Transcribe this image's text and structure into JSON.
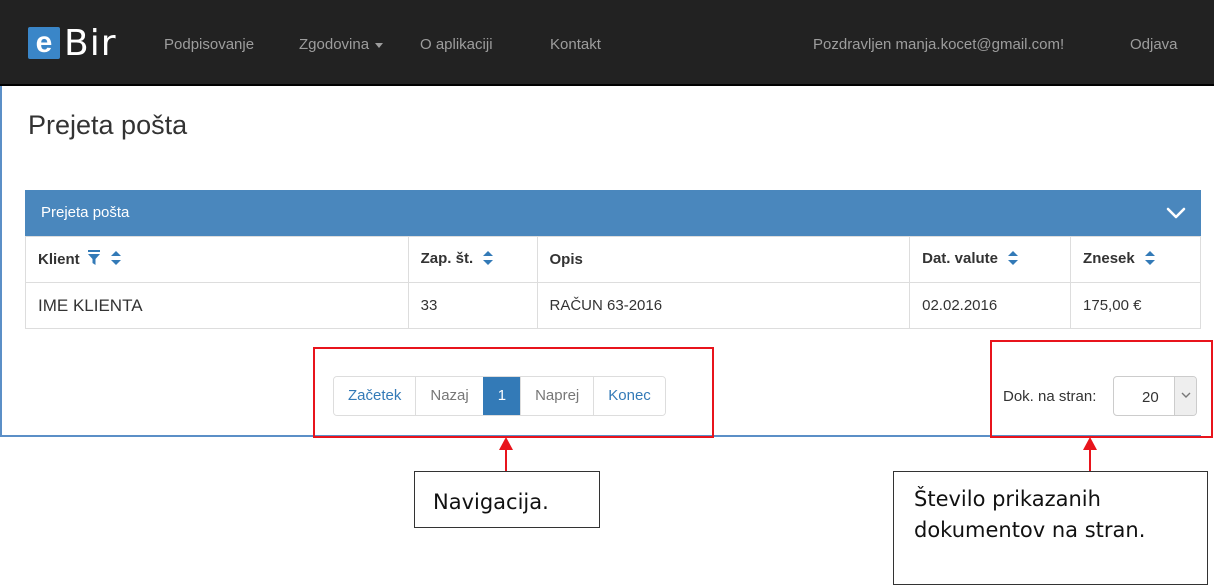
{
  "navbar": {
    "brand_e": "e",
    "brand_rest": "Bir",
    "links": [
      {
        "label": "Podpisovanje"
      },
      {
        "label": "Zgodovina"
      },
      {
        "label": "O aplikaciji"
      },
      {
        "label": "Kontakt"
      }
    ],
    "greeting": "Pozdravljen manja.kocet@gmail.com!",
    "logout": "Odjava"
  },
  "page": {
    "title": "Prejeta pošta"
  },
  "panel": {
    "title": "Prejeta pošta",
    "columns": [
      "Klient",
      "Zap. št.",
      "Opis",
      "Dat. valute",
      "Znesek"
    ],
    "rows": [
      {
        "klient": "IME KLIENTA",
        "zap_st": "33",
        "opis": "RAČUN 63-2016",
        "dat_valute": "02.02.2016",
        "znesek": "175,00 €"
      }
    ]
  },
  "pagination": {
    "first": "Začetek",
    "prev": "Nazaj",
    "current": "1",
    "next": "Naprej",
    "last": "Konec"
  },
  "page_size": {
    "label": "Dok. na stran:",
    "value": "20"
  },
  "annotations": {
    "navigation": "Navigacija.",
    "page_size_line1": "Število prikazanih",
    "page_size_line2": "dokumentov na stran."
  },
  "colors": {
    "navbar_bg": "#222222",
    "panel_heading": "#4a87bd",
    "accent": "#337ab7",
    "annotation_red": "#e8141c"
  }
}
